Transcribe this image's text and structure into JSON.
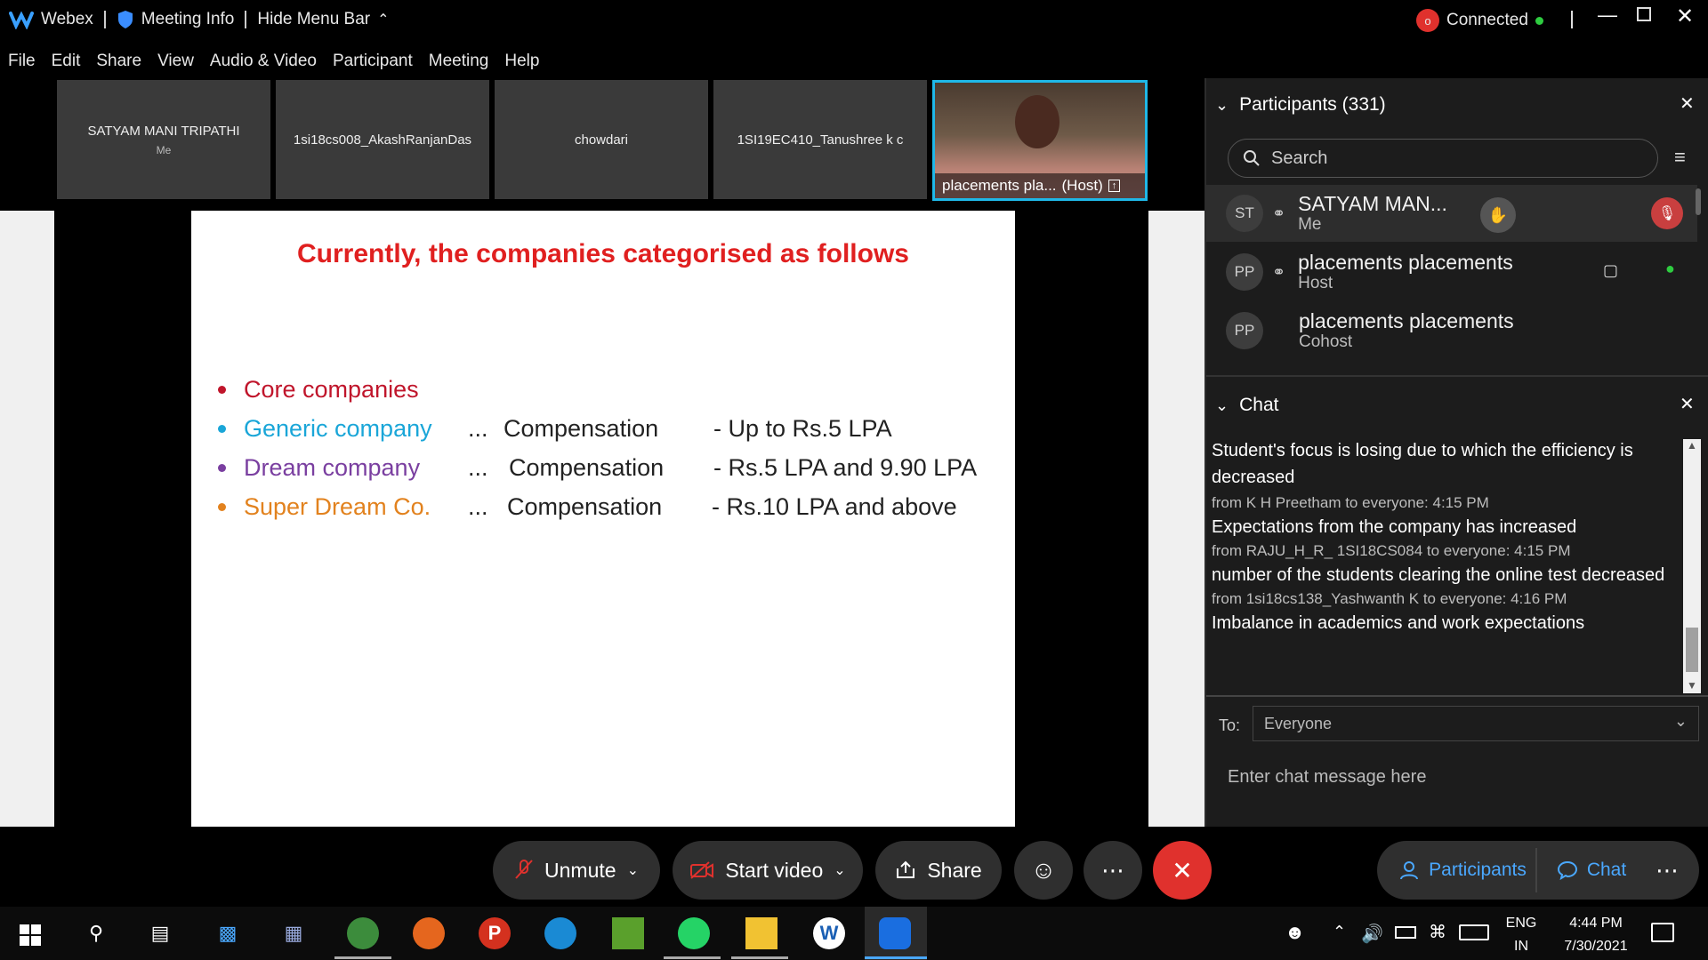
{
  "titlebar": {
    "app_name": "Webex",
    "meeting_info": "Meeting Info",
    "hide_menu": "Hide Menu Bar",
    "status": "Connected"
  },
  "menu": [
    "File",
    "Edit",
    "Share",
    "View",
    "Audio & Video",
    "Participant",
    "Meeting",
    "Help"
  ],
  "thumbnails": [
    {
      "name": "SATYAM MANI TRIPATHI",
      "sub": "Me"
    },
    {
      "name": "1si18cs008_AkashRanjanDas"
    },
    {
      "name": "chowdari"
    },
    {
      "name": "1SI19EC410_Tanushree k c"
    },
    {
      "name": "placements pla...",
      "tag": "(Host)"
    }
  ],
  "slide": {
    "title": "Currently, the companies categorised as follows",
    "rows": [
      {
        "label": "Core companies",
        "color": "#c0152b",
        "dots": "",
        "comp": "",
        "range": ""
      },
      {
        "label": "Generic company",
        "color": "#1aa6d8",
        "dots": "...",
        "comp": "Compensation",
        "range": "- Up to Rs.5 LPA"
      },
      {
        "label": "Dream company",
        "color": "#7a3fa0",
        "dots": "...",
        "comp": "Compensation",
        "range": "- Rs.5 LPA and 9.90 LPA"
      },
      {
        "label": "Super Dream Co.",
        "color": "#e2821e",
        "dots": "...",
        "comp": "Compensation",
        "range": "- Rs.10 LPA and above"
      }
    ]
  },
  "participants": {
    "header": "Participants (331)",
    "search_placeholder": "Search",
    "list": [
      {
        "initials": "ST",
        "name": "SATYAM MAN...",
        "role": "Me"
      },
      {
        "initials": "PP",
        "name": "placements placements",
        "role": "Host"
      },
      {
        "initials": "PP",
        "name": "placements placements",
        "role": "Cohost"
      }
    ]
  },
  "chat": {
    "header": "Chat",
    "messages": [
      {
        "meta": "",
        "text": "Student's focus is losing due to which the efficiency is decreased"
      },
      {
        "meta": "from K H Preetham to everyone:   4:15 PM",
        "text": "Expectations from the company has increased"
      },
      {
        "meta": "from RAJU_H_R_ 1SI18CS084 to everyone:   4:15 PM",
        "text": "number of the students clearing the online test decreased"
      },
      {
        "meta": "from 1si18cs138_Yashwanth K to everyone:   4:16 PM",
        "text": "Imbalance in academics and work expectations"
      }
    ],
    "to_label": "To:",
    "to_value": "Everyone",
    "input_placeholder": "Enter chat message here"
  },
  "controls": {
    "unmute": "Unmute",
    "start_video": "Start video",
    "share": "Share",
    "participants": "Participants",
    "chat": "Chat"
  },
  "taskbar": {
    "lang_top": "ENG",
    "lang_bottom": "IN",
    "time": "4:44 PM",
    "date": "7/30/2021"
  }
}
